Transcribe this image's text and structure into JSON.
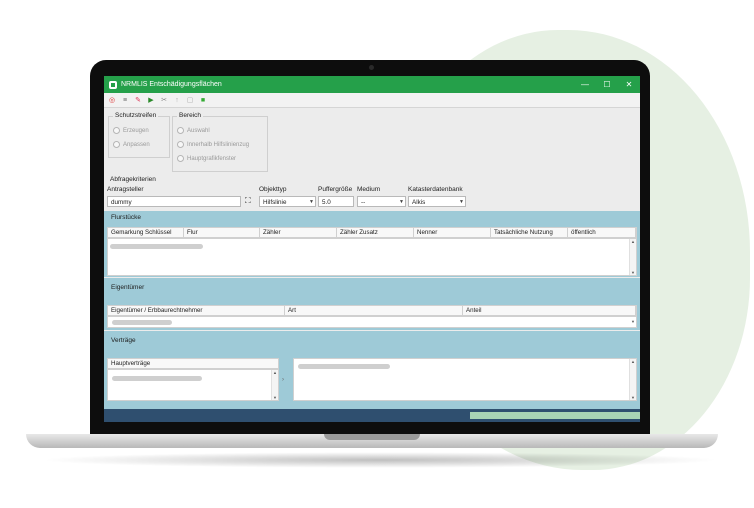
{
  "window": {
    "title": "NRMLIS Entschädigungsflächen",
    "minimize": "—",
    "maximize": "☐",
    "close": "✕"
  },
  "toolbar": {
    "buttons": [
      {
        "icon": "map-icon",
        "glyph": "◎",
        "color": "#d33"
      },
      {
        "icon": "list-icon",
        "glyph": "≡",
        "color": "#666"
      },
      {
        "icon": "pencil-icon",
        "glyph": "✎",
        "color": "#d35"
      },
      {
        "icon": "layers-icon",
        "glyph": "▶",
        "color": "#2a8a2a"
      },
      {
        "icon": "scissors-icon",
        "glyph": "✂",
        "color": "#888"
      },
      {
        "icon": "upload-icon",
        "glyph": "↑",
        "color": "#aaa"
      },
      {
        "icon": "document-icon",
        "glyph": "▢",
        "color": "#aaa"
      },
      {
        "icon": "export-icon",
        "glyph": "■",
        "color": "#3a3"
      }
    ]
  },
  "schutzstreifen": {
    "title": "Schutzstreifen",
    "options": [
      "Erzeugen",
      "Anpassen"
    ]
  },
  "bereich": {
    "title": "Bereich",
    "options": [
      "Auswahl",
      "Innerhalb Hilfslinienzug",
      "Hauptgrafikfenster"
    ]
  },
  "abfrage": {
    "title": "Abfragekriterien",
    "antragsteller_label": "Antragsteller",
    "antragsteller_value": "dummy",
    "objekttyp_label": "Objekttyp",
    "objekttyp_value": "Hilfslinie",
    "puffer_label": "Puffergröße",
    "puffer_value": "5.0",
    "medium_label": "Medium",
    "medium_value": "--",
    "kataster_label": "Katasterdatenbank",
    "kataster_value": "Alkis"
  },
  "flurstuecke": {
    "title": "Flurstücke",
    "columns": [
      "Gemarkung Schlüssel",
      "Flur",
      "Zähler",
      "Zähler Zusatz",
      "Nenner",
      "Tatsächliche Nutzung",
      "öffentlich"
    ]
  },
  "eigentuemer": {
    "title": "Eigentümer",
    "columns": [
      "Eigentümer / Erbbaurechtnehmer",
      "Art",
      "Anteil"
    ]
  },
  "vertraege": {
    "title": "Verträge",
    "list_header": "Hauptverträge"
  },
  "colors": {
    "accent": "#25a04a",
    "section": "#9ecad7",
    "statusbar": "#2f4f6f"
  }
}
